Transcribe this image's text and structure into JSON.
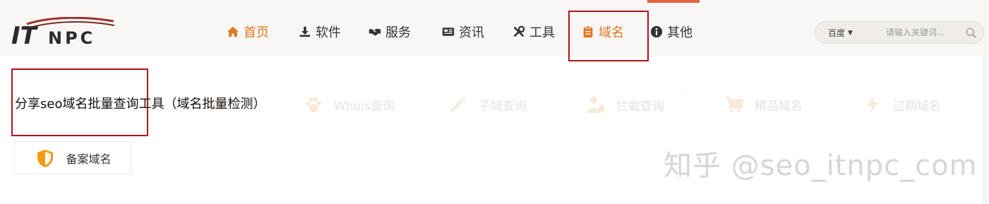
{
  "logo": {
    "text_it": "IT",
    "text_npc": "NPC"
  },
  "nav": {
    "items": [
      {
        "label": "首页",
        "icon": "home-icon"
      },
      {
        "label": "软件",
        "icon": "download-icon"
      },
      {
        "label": "服务",
        "icon": "handshake-icon"
      },
      {
        "label": "资讯",
        "icon": "newspaper-icon"
      },
      {
        "label": "工具",
        "icon": "tools-icon"
      },
      {
        "label": "域名",
        "icon": "clipboard-icon",
        "active": true
      },
      {
        "label": "其他",
        "icon": "info-icon"
      }
    ]
  },
  "search": {
    "engine": "百度",
    "placeholder": "请输入关键词..."
  },
  "page": {
    "title": "分享seo域名批量查询工具（域名批量检测）"
  },
  "tools": {
    "items": [
      {
        "label": "Whois查询",
        "icon": "paw-icon"
      },
      {
        "label": "子域查询",
        "icon": "magic-wand-icon"
      },
      {
        "label": "拦截查询",
        "icon": "user-shield-icon"
      },
      {
        "label": "精品域名",
        "icon": "cart-icon"
      },
      {
        "label": "过期域名",
        "icon": "bolt-icon"
      }
    ],
    "record_domain": {
      "label": "备案域名",
      "icon": "shield-icon"
    }
  },
  "watermark": "知乎 @seo_itnpc_com",
  "colors": {
    "accent": "#e07a1f",
    "highlight": "#b3121d",
    "top_accent": "#e4633f"
  }
}
